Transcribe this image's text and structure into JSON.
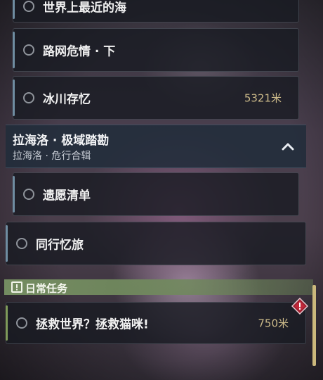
{
  "task_list": {
    "items": [
      {
        "label": "世界上最近的海",
        "distance": ""
      },
      {
        "label": "路网危情 · 下",
        "distance": ""
      },
      {
        "label": "冰川存忆",
        "distance": "5321米"
      }
    ],
    "group": {
      "title": "拉海洛 · 极域踏勘",
      "subtitle": "拉海洛 · 危行合辑",
      "items": [
        {
          "label": "遗愿清单",
          "distance": ""
        }
      ]
    },
    "standalone": {
      "label": "同行忆旅",
      "distance": ""
    }
  },
  "daily": {
    "header": "日常任务",
    "items": [
      {
        "label": "拯救世界？拯救猫咪!",
        "distance": "750米"
      }
    ]
  },
  "colors": {
    "accent_gold": "#cdbb8a",
    "daily_green": "#7f9a5a",
    "alert_red": "#c0283a",
    "scroll_thumb": "#cbb87c"
  },
  "icons": {
    "group_toggle": "chevron-up-icon",
    "daily_header": "exclamation-box-icon",
    "alert": "warning-diamond-icon"
  }
}
